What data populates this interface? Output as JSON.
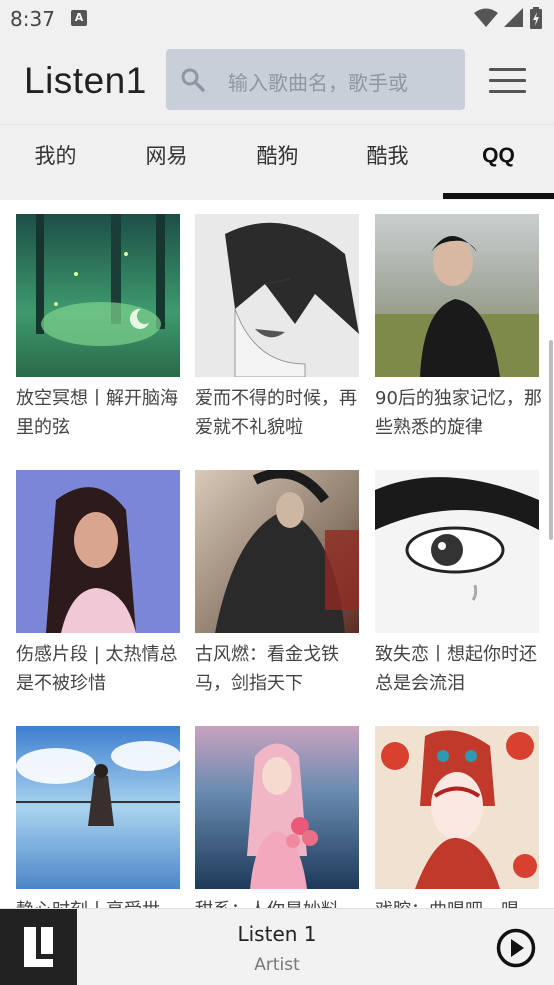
{
  "status_bar": {
    "time": "8:37",
    "notification_icon": "A"
  },
  "header": {
    "app_title": "Listen1",
    "search_placeholder": "输入歌曲名，歌手或",
    "search_icon": "search-icon",
    "menu_icon": "hamburger-menu-icon"
  },
  "tabs": [
    {
      "label": "我的",
      "active": false
    },
    {
      "label": "网易",
      "active": false
    },
    {
      "label": "酷狗",
      "active": false
    },
    {
      "label": "酷我",
      "active": false
    },
    {
      "label": "QQ",
      "active": true
    }
  ],
  "playlists": [
    {
      "title": "放空冥想丨解开脑海里的弦"
    },
    {
      "title": "爱而不得的时候，再爱就不礼貌啦"
    },
    {
      "title": "90后的独家记忆，那些熟悉的旋律"
    },
    {
      "title": "伤感片段 | 太热情总是不被珍惜"
    },
    {
      "title": "古风燃：看金戈铁马，剑指天下"
    },
    {
      "title": "致失恋丨想起你时还总是会流泪"
    },
    {
      "title": "静心时刻丨享受世"
    },
    {
      "title": "甜系：人你是妙料"
    },
    {
      "title": "戏腔：曲唱吧，唱"
    }
  ],
  "player": {
    "title": "Listen 1",
    "artist": "Artist",
    "play_icon": "play-icon"
  },
  "colors": {
    "header_bg": "#f0f0f0",
    "search_bg": "#c8cfd8",
    "active_tab_indicator": "#111111",
    "player_logo_bg": "#222222"
  }
}
